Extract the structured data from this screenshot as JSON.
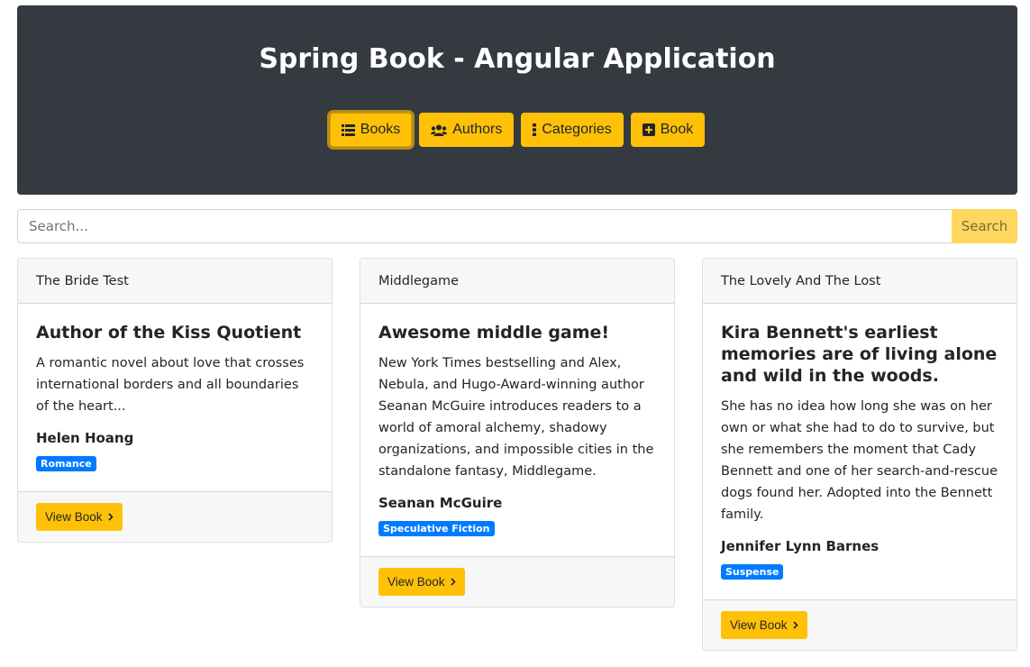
{
  "header": {
    "title": "Spring Book - Angular Application",
    "nav": [
      {
        "label": "Books",
        "icon": "list-icon",
        "active": true
      },
      {
        "label": "Authors",
        "icon": "users-icon",
        "active": false
      },
      {
        "label": "Categories",
        "icon": "ellipsis-vertical-icon",
        "active": false
      },
      {
        "label": "Book",
        "icon": "plus-square-icon",
        "active": false
      }
    ]
  },
  "search": {
    "placeholder": "Search...",
    "value": "",
    "button_label": "Search"
  },
  "books": [
    {
      "header": "The Bride Test",
      "title": "Author of the Kiss Quotient",
      "description": "A romantic novel about love that crosses international borders and all boundaries of the heart...",
      "author": "Helen Hoang",
      "category": "Romance",
      "button_label": "View Book"
    },
    {
      "header": "Middlegame",
      "title": "Awesome middle game!",
      "description": "New York Times bestselling and Alex, Nebula, and Hugo-Award-winning author Seanan McGuire introduces readers to a world of amoral alchemy, shadowy organizations, and impossible cities in the standalone fantasy, Middlegame.",
      "author": "Seanan McGuire",
      "category": "Speculative Fiction",
      "button_label": "View Book"
    },
    {
      "header": "The Lovely And The Lost",
      "title": "Kira Bennett's earliest memories are of living alone and wild in the woods.",
      "description": "She has no idea how long she was on her own or what she had to do to survive, but she remembers the moment that Cady Bennett and one of her search-and-rescue dogs found her. Adopted into the Bennett family.",
      "author": "Jennifer Lynn Barnes",
      "category": "Suspense",
      "button_label": "View Book"
    }
  ],
  "colors": {
    "header_bg": "#343a40",
    "accent": "#ffc107",
    "badge": "#007bff"
  }
}
